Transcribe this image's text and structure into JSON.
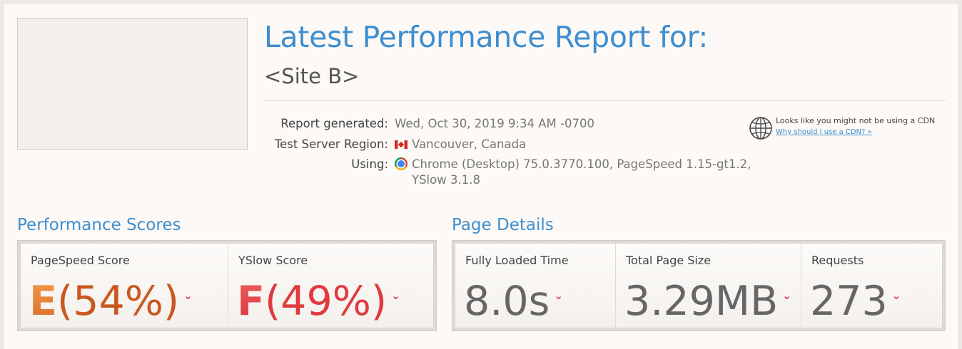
{
  "header": {
    "title": "Latest Performance Report for:",
    "site": "<Site B>"
  },
  "meta": {
    "report_generated_label": "Report generated:",
    "report_generated_value": "Wed, Oct 30, 2019 9:34 AM -0700",
    "region_label": "Test Server Region:",
    "region_value": "Vancouver, Canada",
    "using_label": "Using:",
    "using_value_line1": "Chrome (Desktop) 75.0.3770.100, PageSpeed 1.15-gt1.2,",
    "using_value_line2": "YSlow 3.1.8"
  },
  "cdn": {
    "text": "Looks like you might not be using a CDN",
    "link": "Why should I use a CDN? »"
  },
  "performance": {
    "heading": "Performance Scores",
    "pagespeed": {
      "label": "PageSpeed Score",
      "grade": "E",
      "percent": "(54%)"
    },
    "yslow": {
      "label": "YSlow Score",
      "grade": "F",
      "percent": "(49%)"
    }
  },
  "details": {
    "heading": "Page Details",
    "loaded": {
      "label": "Fully Loaded Time",
      "value": "8.0s"
    },
    "size": {
      "label": "Total Page Size",
      "value": "3.29MB"
    },
    "requests": {
      "label": "Requests",
      "value": "273"
    }
  },
  "colors": {
    "accent": "#3e8ed0",
    "grade_e": "#e2833a",
    "grade_f": "#e04848",
    "caret": "#e0334a"
  },
  "icons": {
    "caret": "⌄",
    "globe": "globe-icon",
    "flag": "canada-flag-icon",
    "browser": "chrome-icon"
  }
}
